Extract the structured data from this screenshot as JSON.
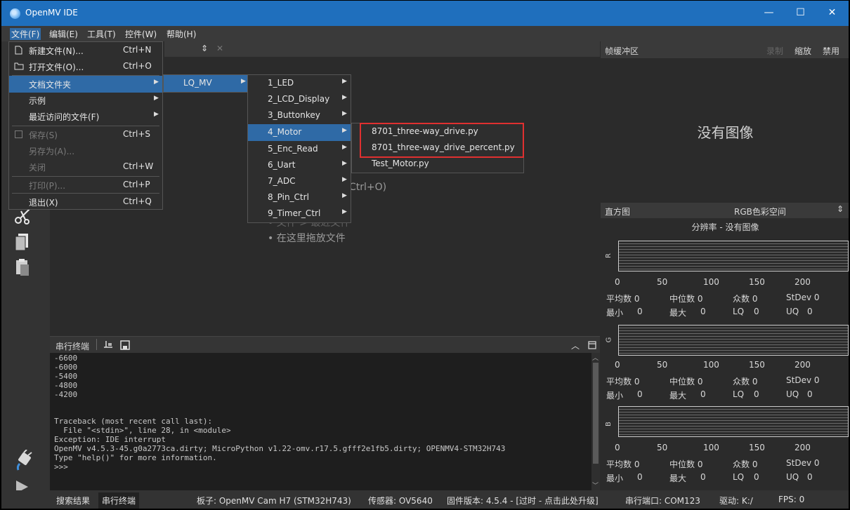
{
  "app": {
    "title": "OpenMV IDE"
  },
  "window_controls": {
    "minimize": "—",
    "maximize": "☐",
    "close": "✕"
  },
  "menubar": [
    {
      "label": "文件(F)"
    },
    {
      "label": "编辑(E)"
    },
    {
      "label": "工具(T)"
    },
    {
      "label": "控件(W)"
    },
    {
      "label": "帮助(H)"
    }
  ],
  "file_menu": {
    "items": [
      {
        "label": "新建文件(N)...",
        "shortcut": "Ctrl+N",
        "icon": "new-file-icon",
        "enabled": true
      },
      {
        "label": "打开文件(O)...",
        "shortcut": "Ctrl+O",
        "icon": "open-folder-icon",
        "enabled": true
      },
      {
        "label": "文档文件夹",
        "shortcut": "",
        "submenu": true,
        "enabled": true,
        "selected": true
      },
      {
        "label": "示例",
        "shortcut": "",
        "submenu": true,
        "enabled": true
      },
      {
        "label": "最近访问的文件(F)",
        "shortcut": "",
        "submenu": true,
        "enabled": true
      },
      {
        "label": "保存(S)",
        "shortcut": "Ctrl+S",
        "icon": "save-icon",
        "enabled": false
      },
      {
        "label": "另存为(A)...",
        "shortcut": "",
        "enabled": false
      },
      {
        "label": "关闭",
        "shortcut": "Ctrl+W",
        "enabled": false
      },
      {
        "label": "打印(P)...",
        "shortcut": "Ctrl+P",
        "enabled": false
      },
      {
        "label": "退出(X)",
        "shortcut": "Ctrl+Q",
        "enabled": true
      }
    ]
  },
  "docs_submenu": {
    "items": [
      {
        "label": "LQ_MV",
        "selected": true
      }
    ]
  },
  "lqmv_submenu": {
    "items": [
      {
        "label": "1_LED"
      },
      {
        "label": "2_LCD_Display"
      },
      {
        "label": "3_Buttonkey"
      },
      {
        "label": "4_Motor",
        "selected": true
      },
      {
        "label": "5_Enc_Read"
      },
      {
        "label": "6_Uart"
      },
      {
        "label": "7_ADC"
      },
      {
        "label": "8_Pin_Ctrl"
      },
      {
        "label": "9_Timer_Ctrl"
      }
    ]
  },
  "motor_submenu": {
    "items": [
      {
        "label": "8701_three-way_drive.py"
      },
      {
        "label": "8701_three-way_drive_percent.py"
      },
      {
        "label": "Test_Motor.py"
      }
    ]
  },
  "editor": {
    "tab_arrows": "⇕",
    "tab_close": "✕",
    "hint_open_fragment": "Ctrl+O)",
    "hint_recent_fragment": "• 文件 > 最近文件",
    "hint_drag": "• 在这里拖放文件"
  },
  "framebuffer": {
    "title": "帧缓冲区",
    "record": "录制",
    "zoom": "缩放",
    "disable": "禁用",
    "no_image": "没有图像"
  },
  "histogram": {
    "title": "直方图",
    "colorspace": "RGB色彩空间",
    "resolution": "分辨率 - 没有图像",
    "ticks": [
      "0",
      "50",
      "100",
      "150",
      "200"
    ],
    "channels": [
      {
        "name": "R",
        "mean": "平均数 0",
        "median": "中位数 0",
        "mode": "众数 0",
        "stdev": "StDev 0",
        "min": "最小",
        "min_val": "0",
        "max": "最大",
        "max_val": "0",
        "lq": "LQ",
        "lq_val": "0",
        "uq": "UQ",
        "uq_val": "0"
      },
      {
        "name": "G",
        "mean": "平均数 0",
        "median": "中位数 0",
        "mode": "众数 0",
        "stdev": "StDev 0",
        "min": "最小",
        "min_val": "0",
        "max": "最大",
        "max_val": "0",
        "lq": "LQ",
        "lq_val": "0",
        "uq": "UQ",
        "uq_val": "0"
      },
      {
        "name": "B",
        "mean": "平均数 0",
        "median": "中位数 0",
        "mode": "众数 0",
        "stdev": "StDev 0",
        "min": "最小",
        "min_val": "0",
        "max": "最大",
        "max_val": "0",
        "lq": "LQ",
        "lq_val": "0",
        "uq": "UQ",
        "uq_val": "0"
      }
    ]
  },
  "terminal": {
    "title": "串行终端",
    "lines": [
      "-6600",
      "-6000",
      "-5400",
      "-4800",
      "-4200",
      "",
      "Traceback (most recent call last):",
      "  File \"<stdin>\", line 28, in <module>",
      "Exception: IDE interrupt",
      "OpenMV v4.5.3-45.g0a2773ca.dirty; MicroPython v1.22-omv.r17.5.gfff2e1fb5.dirty; OPENMV4-STM32H743",
      "Type \"help()\" for more information.",
      ">>>"
    ]
  },
  "statusbar": {
    "search_results": "搜索结果",
    "serial_terminal": "串行终端",
    "board": "板子: OpenMV Cam H7 (STM32H743)",
    "sensor": "传感器: OV5640",
    "firmware": "固件版本: 4.5.4 - [过时 - 点击此处升级]",
    "port": "串行端口: COM123",
    "drive": "驱动: K:/",
    "fps": "FPS: 0"
  },
  "colors": {
    "accent": "#2f6aa6",
    "titlebar": "#1f6fbd",
    "highlight_box": "#e03030"
  }
}
